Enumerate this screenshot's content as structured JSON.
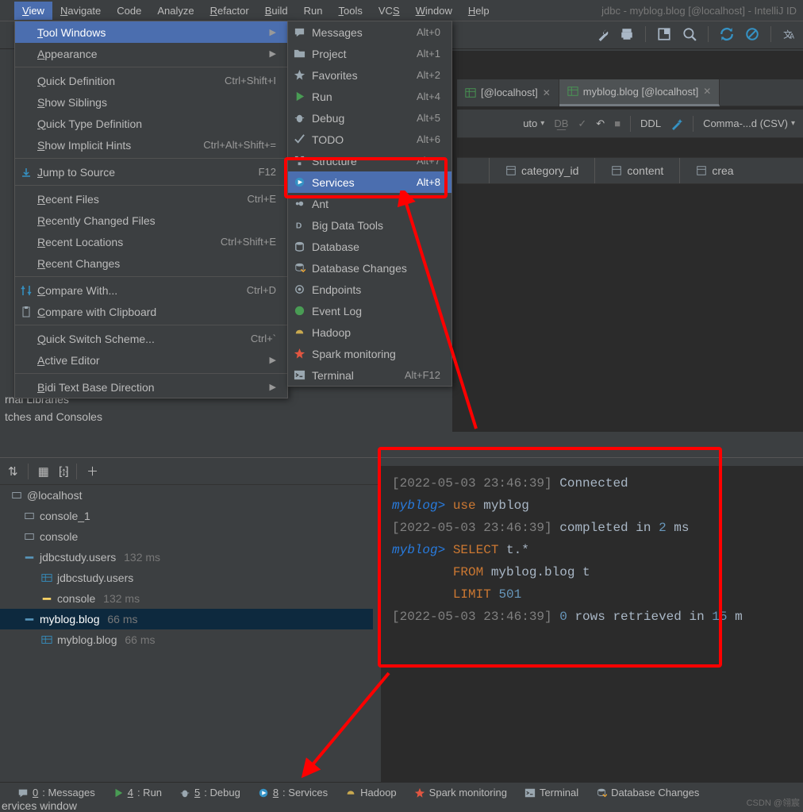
{
  "app_title": "jdbc - myblog.blog [@localhost] - IntelliJ ID",
  "menu_bar": [
    "View",
    "Navigate",
    "Code",
    "Analyze",
    "Refactor",
    "Build",
    "Run",
    "Tools",
    "VCS",
    "Window",
    "Help"
  ],
  "menu_uls": [
    "V",
    "N",
    "",
    "",
    "R",
    "B",
    "",
    "T",
    "S",
    "W",
    "H"
  ],
  "view_menu": [
    {
      "label": "Tool Windows",
      "highlight": true,
      "arrow": true
    },
    {
      "label": "Appearance",
      "arrow": true
    },
    {
      "sep": true
    },
    {
      "label": "Quick Definition",
      "shortcut": "Ctrl+Shift+I"
    },
    {
      "label": "Show Siblings"
    },
    {
      "label": "Quick Type Definition"
    },
    {
      "label": "Show Implicit Hints",
      "shortcut": "Ctrl+Alt+Shift+="
    },
    {
      "sep": true
    },
    {
      "icon": "jump",
      "label": "Jump to Source",
      "shortcut": "F12"
    },
    {
      "sep": true
    },
    {
      "label": "Recent Files",
      "shortcut": "Ctrl+E"
    },
    {
      "label": "Recently Changed Files"
    },
    {
      "label": "Recent Locations",
      "shortcut": "Ctrl+Shift+E"
    },
    {
      "label": "Recent Changes"
    },
    {
      "sep": true
    },
    {
      "icon": "compare",
      "label": "Compare With...",
      "shortcut": "Ctrl+D"
    },
    {
      "icon": "clip",
      "label": "Compare with Clipboard"
    },
    {
      "sep": true
    },
    {
      "label": "Quick Switch Scheme...",
      "shortcut": "Ctrl+`"
    },
    {
      "label": "Active Editor",
      "arrow": true
    },
    {
      "sep": true
    },
    {
      "label": "Bidi Text Base Direction",
      "arrow": true
    }
  ],
  "tool_windows": [
    {
      "icon": "msg",
      "label": "Messages",
      "shortcut": "Alt+0"
    },
    {
      "icon": "folder",
      "label": "Project",
      "shortcut": "Alt+1"
    },
    {
      "icon": "star",
      "label": "Favorites",
      "shortcut": "Alt+2"
    },
    {
      "icon": "play",
      "label": "Run",
      "shortcut": "Alt+4"
    },
    {
      "icon": "bug",
      "label": "Debug",
      "shortcut": "Alt+5"
    },
    {
      "icon": "check",
      "label": "TODO",
      "shortcut": "Alt+6"
    },
    {
      "icon": "struct",
      "label": "Structure",
      "shortcut": "Alt+7"
    },
    {
      "icon": "services",
      "label": "Services",
      "shortcut": "Alt+8",
      "services": true
    },
    {
      "icon": "ant",
      "label": "Ant"
    },
    {
      "icon": "bigdata",
      "label": "Big Data Tools"
    },
    {
      "icon": "db",
      "label": "Database"
    },
    {
      "icon": "dbch",
      "label": "Database Changes"
    },
    {
      "icon": "endpoint",
      "label": "Endpoints"
    },
    {
      "icon": "evlog",
      "label": "Event Log"
    },
    {
      "icon": "hadoop",
      "label": "Hadoop"
    },
    {
      "icon": "spark",
      "label": "Spark monitoring"
    },
    {
      "icon": "terminal",
      "label": "Terminal",
      "shortcut": "Alt+F12"
    }
  ],
  "editor_tabs": [
    {
      "label": "[@localhost]",
      "active": false,
      "closable": true
    },
    {
      "label": "myblog.blog [@localhost]",
      "active": true,
      "closable": true
    }
  ],
  "db_toolbar": {
    "auto": "uto",
    "ddl": "DDL",
    "format": "Comma-...d (CSV)"
  },
  "table_columns": [
    "category_id",
    "content",
    "crea"
  ],
  "project_fragments": [
    "rnal Libraries",
    "tches and Consoles"
  ],
  "services": {
    "tree": [
      {
        "l": 1,
        "label": "@localhost"
      },
      {
        "l": 2,
        "label": "console_1"
      },
      {
        "l": 2,
        "label": "console"
      },
      {
        "l": 2,
        "label": "jdbcstudy.users",
        "ms": "132 ms",
        "color": "#5896bb"
      },
      {
        "l": 3,
        "label": "jdbcstudy.users",
        "icon": "table"
      },
      {
        "l": 3,
        "label": "console",
        "ms": "132 ms",
        "color": "#ffd866"
      },
      {
        "l": 2,
        "label": "myblog.blog",
        "ms": "66 ms",
        "color": "#5896bb",
        "sel": true
      },
      {
        "l": 3,
        "label": "myblog.blog",
        "ms": "66 ms",
        "icon": "table"
      }
    ],
    "console": [
      {
        "t": "ts",
        "v": "[2022-05-03 23:46:39] "
      },
      {
        "t": "txt",
        "v": "Connected"
      },
      {
        "t": "nl"
      },
      {
        "t": "prompt",
        "v": "myblog> "
      },
      {
        "t": "kw",
        "v": "use"
      },
      {
        "t": "txt",
        "v": " myblog"
      },
      {
        "t": "nl"
      },
      {
        "t": "ts",
        "v": "[2022-05-03 23:46:39] "
      },
      {
        "t": "txt",
        "v": "completed in "
      },
      {
        "t": "num",
        "v": "2"
      },
      {
        "t": "txt",
        "v": " ms"
      },
      {
        "t": "nl"
      },
      {
        "t": "prompt",
        "v": "myblog> "
      },
      {
        "t": "kw",
        "v": "SELECT"
      },
      {
        "t": "txt",
        "v": " t.*"
      },
      {
        "t": "nl"
      },
      {
        "t": "txt",
        "v": "        "
      },
      {
        "t": "kw",
        "v": "FROM"
      },
      {
        "t": "txt",
        "v": " myblog.blog t"
      },
      {
        "t": "nl"
      },
      {
        "t": "txt",
        "v": "        "
      },
      {
        "t": "kw",
        "v": "LIMIT"
      },
      {
        "t": "txt",
        "v": " "
      },
      {
        "t": "num",
        "v": "501"
      },
      {
        "t": "nl"
      },
      {
        "t": "ts",
        "v": "[2022-05-03 23:46:39] "
      },
      {
        "t": "num",
        "v": "0"
      },
      {
        "t": "txt",
        "v": " rows retrieved in "
      },
      {
        "t": "num",
        "v": "15"
      },
      {
        "t": "txt",
        "v": " m"
      }
    ]
  },
  "status_bar": [
    {
      "icon": "msg",
      "u": "0",
      "label": ": Messages"
    },
    {
      "icon": "play",
      "u": "4",
      "label": ": Run"
    },
    {
      "icon": "bug",
      "u": "5",
      "label": ": Debug"
    },
    {
      "icon": "services",
      "u": "8",
      "label": ": Services"
    },
    {
      "icon": "hadoop",
      "u": "",
      "label": "Hadoop"
    },
    {
      "icon": "spark",
      "u": "",
      "label": "Spark monitoring"
    },
    {
      "icon": "terminal",
      "u": "",
      "label": "Terminal"
    },
    {
      "icon": "dbch",
      "u": "",
      "label": "Database Changes"
    }
  ],
  "hint": "ervices window",
  "watermark": "CSDN @翎宸"
}
